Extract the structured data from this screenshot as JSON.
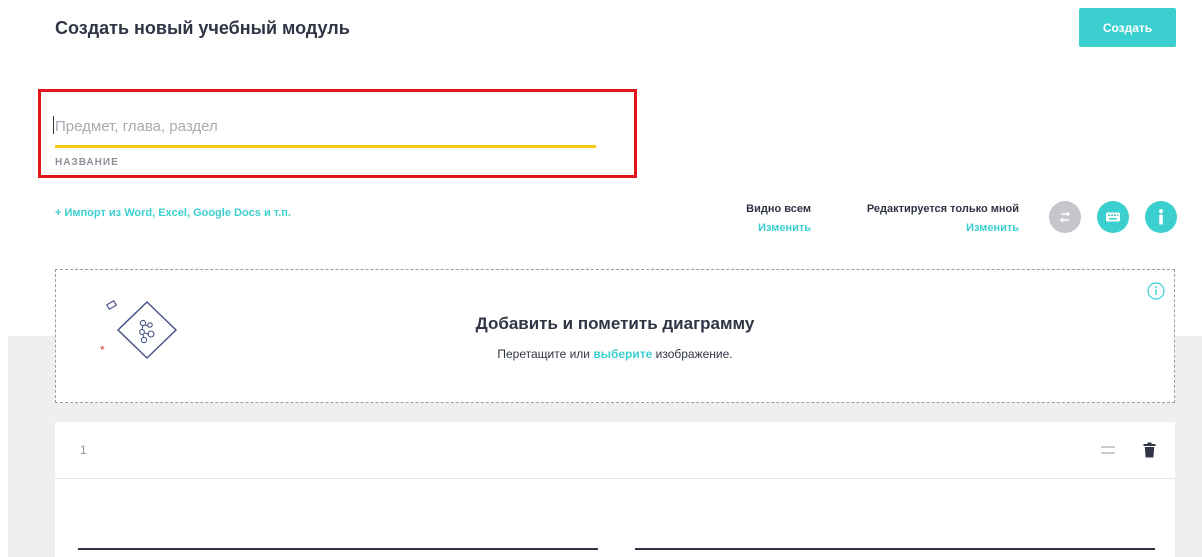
{
  "header": {
    "title": "Создать новый учебный модуль",
    "create_button": "Создать"
  },
  "title_field": {
    "placeholder": "Предмет, глава, раздел",
    "value": "",
    "label": "НАЗВАНИЕ"
  },
  "import_link": "+ Импорт из Word, Excel, Google Docs и т.п.",
  "visibility": {
    "seen_by": "Видно всем",
    "seen_change": "Изменить",
    "editable_by": "Редактируется только мной",
    "editable_change": "Изменить"
  },
  "icons": {
    "swap": "swap-arrows-icon",
    "keyboard": "keyboard-icon",
    "info": "info-icon"
  },
  "diagram": {
    "title": "Добавить и пометить диаграмму",
    "subtitle_before": "Перетащите или",
    "subtitle_link": "выберите",
    "subtitle_after": "изображение."
  },
  "card": {
    "number": "1"
  },
  "colors": {
    "accent": "#3ccfcf",
    "underline": "#f6c915",
    "highlight_border": "#e2151a",
    "text": "#303545",
    "muted": "#8e909a"
  }
}
